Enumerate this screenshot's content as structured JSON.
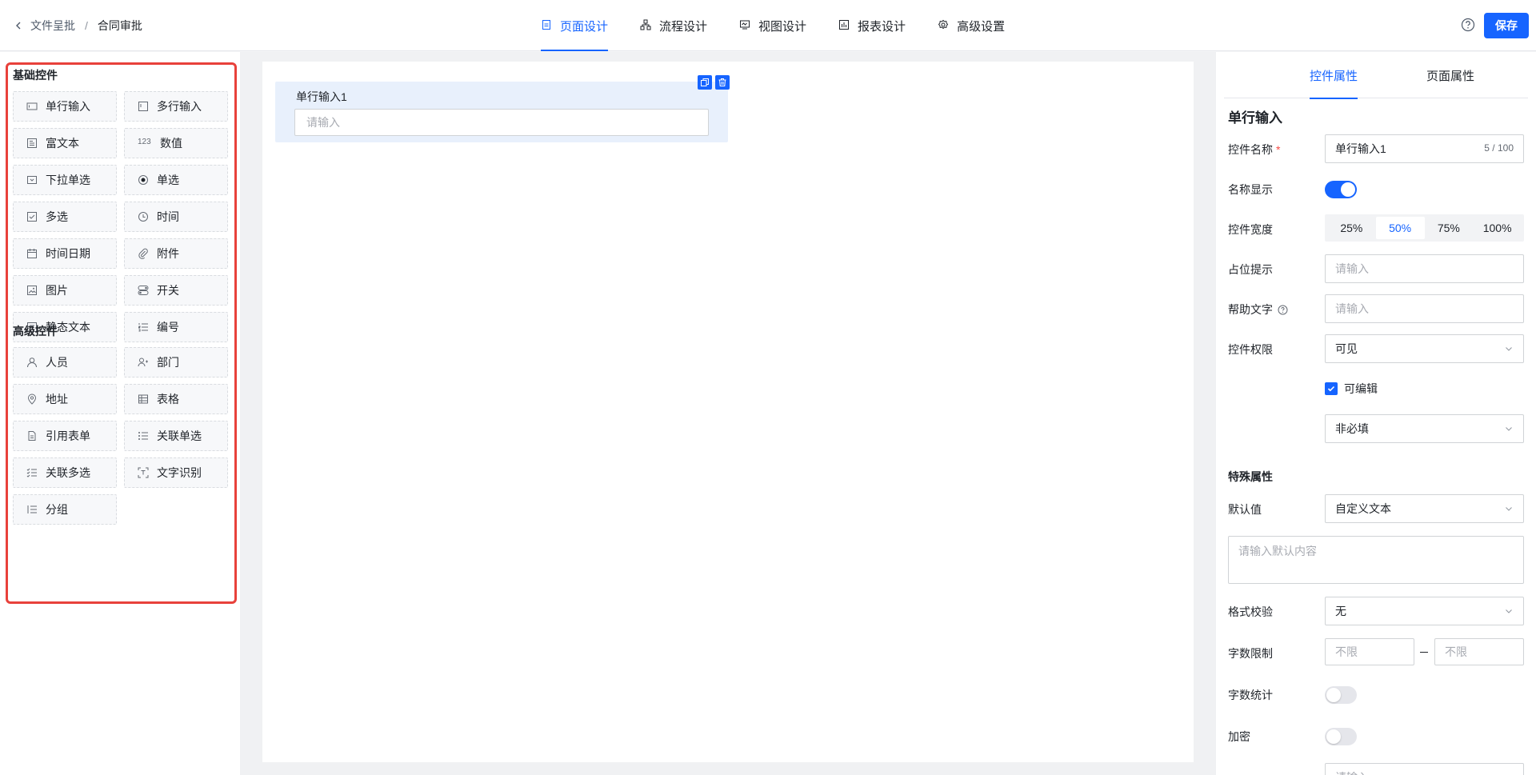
{
  "header": {
    "breadcrumb": [
      "文件呈批",
      "合同审批"
    ],
    "separator": "/",
    "tabs": [
      {
        "label": "页面设计",
        "icon": "page-icon",
        "active": true
      },
      {
        "label": "流程设计",
        "icon": "flow-icon",
        "active": false
      },
      {
        "label": "视图设计",
        "icon": "view-icon",
        "active": false
      },
      {
        "label": "报表设计",
        "icon": "report-icon",
        "active": false
      },
      {
        "label": "高级设置",
        "icon": "gear-icon",
        "active": false
      }
    ],
    "save_label": "保存"
  },
  "palette": {
    "basic_title": "基础控件",
    "basic": [
      {
        "label": "单行输入",
        "icon": "single-line-icon"
      },
      {
        "label": "多行输入",
        "icon": "multi-line-icon"
      },
      {
        "label": "富文本",
        "icon": "rich-text-icon"
      },
      {
        "label": "数值",
        "icon": "number-icon",
        "glyph": "123"
      },
      {
        "label": "下拉单选",
        "icon": "dropdown-icon"
      },
      {
        "label": "单选",
        "icon": "radio-icon"
      },
      {
        "label": "多选",
        "icon": "checkbox-icon"
      },
      {
        "label": "时间",
        "icon": "clock-icon"
      },
      {
        "label": "时间日期",
        "icon": "calendar-icon"
      },
      {
        "label": "附件",
        "icon": "paperclip-icon"
      },
      {
        "label": "图片",
        "icon": "image-icon"
      },
      {
        "label": "开关",
        "icon": "switch-icon"
      },
      {
        "label": "静态文本",
        "icon": "static-text-icon"
      },
      {
        "label": "编号",
        "icon": "numbered-list-icon"
      }
    ],
    "advanced_title": "高级控件",
    "advanced": [
      {
        "label": "人员",
        "icon": "person-icon"
      },
      {
        "label": "部门",
        "icon": "department-icon"
      },
      {
        "label": "地址",
        "icon": "location-icon"
      },
      {
        "label": "表格",
        "icon": "table-icon"
      },
      {
        "label": "引用表单",
        "icon": "document-icon"
      },
      {
        "label": "关联单选",
        "icon": "list-icon"
      },
      {
        "label": "关联多选",
        "icon": "checklist-icon"
      },
      {
        "label": "文字识别",
        "icon": "scan-text-icon"
      },
      {
        "label": "分组",
        "icon": "group-icon"
      }
    ]
  },
  "canvas": {
    "field_label": "单行输入1",
    "field_placeholder": "请输入"
  },
  "props": {
    "tabs": [
      "控件属性",
      "页面属性"
    ],
    "title": "单行输入",
    "name_label": "控件名称",
    "required_mark": "*",
    "name_value": "单行输入1",
    "name_count": "5 / 100",
    "show_name_label": "名称显示",
    "width_label": "控件宽度",
    "width_options": [
      "25%",
      "50%",
      "75%",
      "100%"
    ],
    "width_active": "50%",
    "placeholder_label": "占位提示",
    "placeholder_hint": "请输入",
    "help_label": "帮助文字",
    "help_hint": "请输入",
    "permission_label": "控件权限",
    "permission_value": "可见",
    "editable_label": "可编辑",
    "required_value": "非必填",
    "special_title": "特殊属性",
    "default_label": "默认值",
    "default_value": "自定义文本",
    "default_content_hint": "请输入默认内容",
    "format_label": "格式校验",
    "format_value": "无",
    "length_label": "字数限制",
    "length_min_hint": "不限",
    "length_max_hint": "不限",
    "count_label": "字数统计",
    "encrypt_label": "加密",
    "bottom_hint": "请输入"
  },
  "colors": {
    "accent": "#1664ff",
    "highlight_border": "#e8413b",
    "card_bg": "#e8f0fc"
  }
}
